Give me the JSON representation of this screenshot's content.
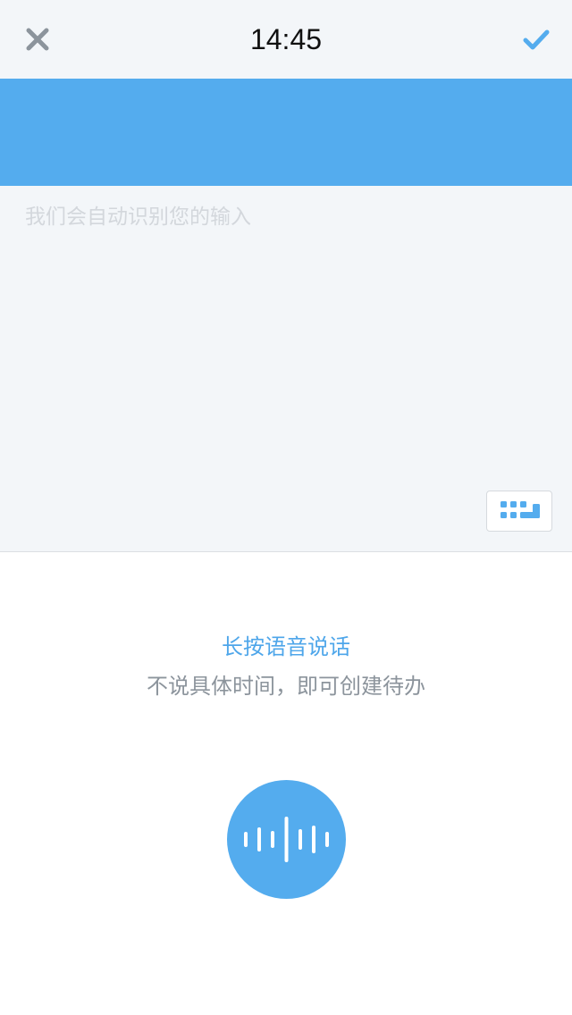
{
  "header": {
    "time": "14:45",
    "close_icon": "close-icon",
    "confirm_icon": "checkmark-icon"
  },
  "input": {
    "placeholder": "我们会自动识别您的输入",
    "keyboard_icon": "keyboard-icon"
  },
  "voice": {
    "title": "长按语音说话",
    "subtitle": "不说具体时间，即可创建待办",
    "mic_icon": "soundwave-icon"
  },
  "colors": {
    "accent": "#54acee",
    "background": "#f3f6f9",
    "close_icon": "#8c949c",
    "hint_title": "#4ea6ea",
    "hint_sub": "#8c949c",
    "placeholder": "#d3d7dc"
  }
}
